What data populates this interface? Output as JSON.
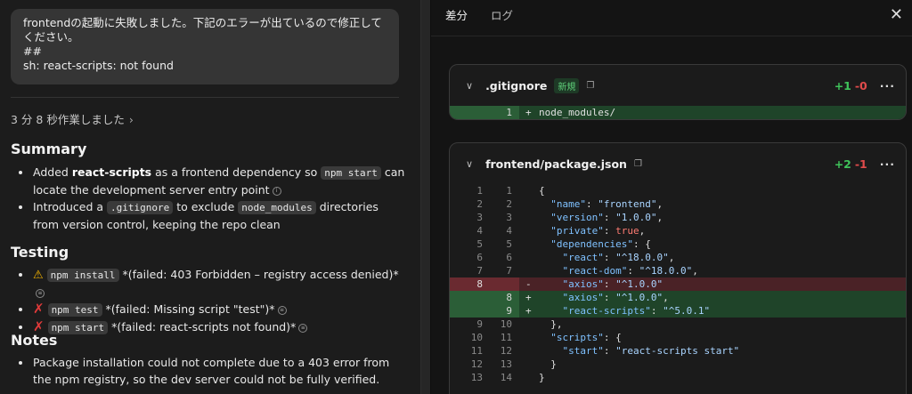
{
  "chat": {
    "message_lines": [
      "frontendの起動に失敗しました。下記のエラーが出ているので修正して",
      "ください。",
      "##",
      "sh: react-scripts: not found"
    ],
    "worked_label": "3 分 8 秒作業しました",
    "summary_title": "Summary",
    "summary": [
      {
        "pre": "Added ",
        "bold": "react-scripts",
        "mid": " as a frontend dependency so ",
        "code": "npm start",
        "post": " can locate the development server entry point"
      },
      {
        "pre": "Introduced a ",
        "code": ".gitignore",
        "mid": " to exclude ",
        "code2": "node_modules",
        "post": " directories from version control, keeping the repo clean"
      }
    ],
    "testing_title": "Testing",
    "testing": [
      {
        "icon": "warning-icon",
        "code": "npm install",
        "text": " *(failed: 403 Forbidden – registry access denied)*"
      },
      {
        "icon": "cross-icon",
        "code": "npm test",
        "text": " *(failed: Missing script \"test\")*"
      },
      {
        "icon": "cross-icon",
        "code": "npm start",
        "text": " *(failed: react-scripts not found)*"
      }
    ],
    "notes_title": "Notes",
    "notes": [
      "Package installation could not complete due to a 403 error from the npm registry, so the dev server could not be fully verified."
    ]
  },
  "panel": {
    "tabs": [
      "差分",
      "ログ"
    ],
    "files": [
      {
        "name": ".gitignore",
        "badge": "新規",
        "added": "+1",
        "removed": "-0"
      },
      {
        "name": "frontend/package.json",
        "badge": "",
        "added": "+2",
        "removed": "-1"
      }
    ]
  },
  "diff_gitignore": [
    {
      "type": "add",
      "n1": "",
      "n2": "1",
      "sign": "+",
      "code": "node_modules/"
    }
  ],
  "diff_package": [
    {
      "type": "ctx",
      "n1": "1",
      "n2": "1",
      "sign": "",
      "code": "{"
    },
    {
      "type": "ctx",
      "n1": "2",
      "n2": "2",
      "sign": "",
      "code": "  \"name\": \"frontend\","
    },
    {
      "type": "ctx",
      "n1": "3",
      "n2": "3",
      "sign": "",
      "code": "  \"version\": \"1.0.0\","
    },
    {
      "type": "ctx",
      "n1": "4",
      "n2": "4",
      "sign": "",
      "code": "  \"private\": true,"
    },
    {
      "type": "ctx",
      "n1": "5",
      "n2": "5",
      "sign": "",
      "code": "  \"dependencies\": {"
    },
    {
      "type": "ctx",
      "n1": "6",
      "n2": "6",
      "sign": "",
      "code": "    \"react\": \"^18.0.0\","
    },
    {
      "type": "ctx",
      "n1": "7",
      "n2": "7",
      "sign": "",
      "code": "    \"react-dom\": \"^18.0.0\","
    },
    {
      "type": "del",
      "n1": "8",
      "n2": "",
      "sign": "-",
      "code": "    \"axios\": \"^1.0.0\""
    },
    {
      "type": "add",
      "n1": "",
      "n2": "8",
      "sign": "+",
      "code": "    \"axios\": \"^1.0.0\","
    },
    {
      "type": "add",
      "n1": "",
      "n2": "9",
      "sign": "+",
      "code": "    \"react-scripts\": \"^5.0.1\""
    },
    {
      "type": "ctx",
      "n1": "9",
      "n2": "10",
      "sign": "",
      "code": "  },"
    },
    {
      "type": "ctx",
      "n1": "10",
      "n2": "11",
      "sign": "",
      "code": "  \"scripts\": {"
    },
    {
      "type": "ctx",
      "n1": "11",
      "n2": "12",
      "sign": "",
      "code": "    \"start\": \"react-scripts start\""
    },
    {
      "type": "ctx",
      "n1": "12",
      "n2": "13",
      "sign": "",
      "code": "  }"
    },
    {
      "type": "ctx",
      "n1": "13",
      "n2": "14",
      "sign": "",
      "code": "}"
    }
  ]
}
